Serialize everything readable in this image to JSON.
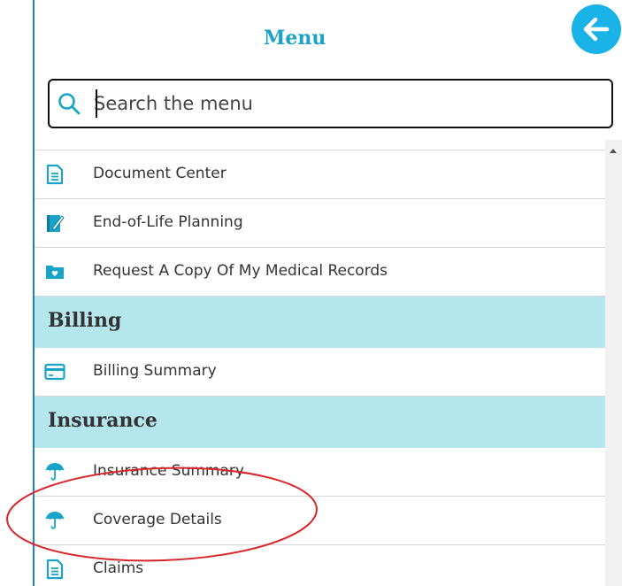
{
  "menu": {
    "title": "Menu",
    "back_icon": "arrow-left-icon"
  },
  "search": {
    "placeholder": "Search the menu",
    "value": ""
  },
  "items": [
    {
      "label": "Document Center",
      "icon": "document-icon"
    },
    {
      "label": "End-of-Life Planning",
      "icon": "notebook-pen-icon"
    },
    {
      "label": "Request A Copy Of My Medical Records",
      "icon": "folder-heart-icon"
    }
  ],
  "sections": {
    "billing": {
      "title": "Billing",
      "items": [
        {
          "label": "Billing Summary",
          "icon": "credit-card-icon"
        }
      ]
    },
    "insurance": {
      "title": "Insurance",
      "items": [
        {
          "label": "Insurance Summary",
          "icon": "umbrella-icon"
        },
        {
          "label": "Coverage Details",
          "icon": "umbrella-icon"
        },
        {
          "label": "Claims",
          "icon": "document-icon"
        }
      ]
    }
  },
  "colors": {
    "accent": "#1aa3c8",
    "back_button": "#1ab3e8",
    "section_bg": "#b4e6ee",
    "annotation": "#d9252a"
  }
}
